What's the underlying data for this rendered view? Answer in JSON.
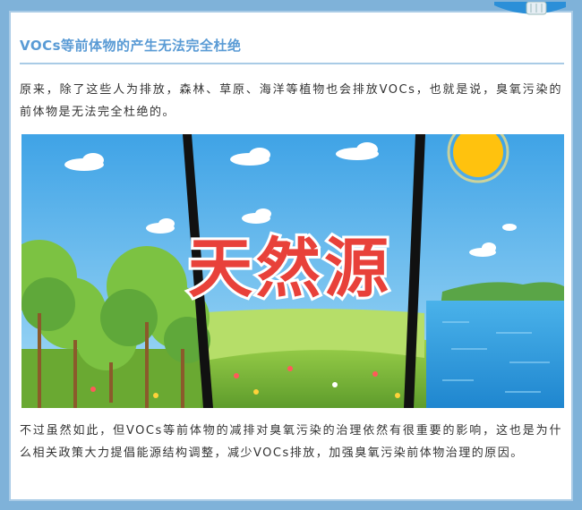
{
  "section": {
    "title": "VOCs等前体物的产生无法完全杜绝"
  },
  "paragraphs": {
    "intro": "原来，除了这些人为排放，森林、草原、海洋等植物也会排放VOCs，也就是说，臭氧污染的前体物是无法完全杜绝的。",
    "conclusion": "不过虽然如此，但VOCs等前体物的减排对臭氧污染的治理依然有很重要的影响，这也是为什么相关政策大力提倡能源结构调整，减少VOCs排放，加强臭氧污染前体物治理的原因。"
  },
  "illustration": {
    "caption": "天然源",
    "colors": {
      "sky": "#63b6ec",
      "grass": "#8cc63f",
      "sea": "#2f9ee0",
      "sun": "#ffc20e",
      "caption_fill": "#e8413a",
      "divider": "#111111"
    }
  }
}
